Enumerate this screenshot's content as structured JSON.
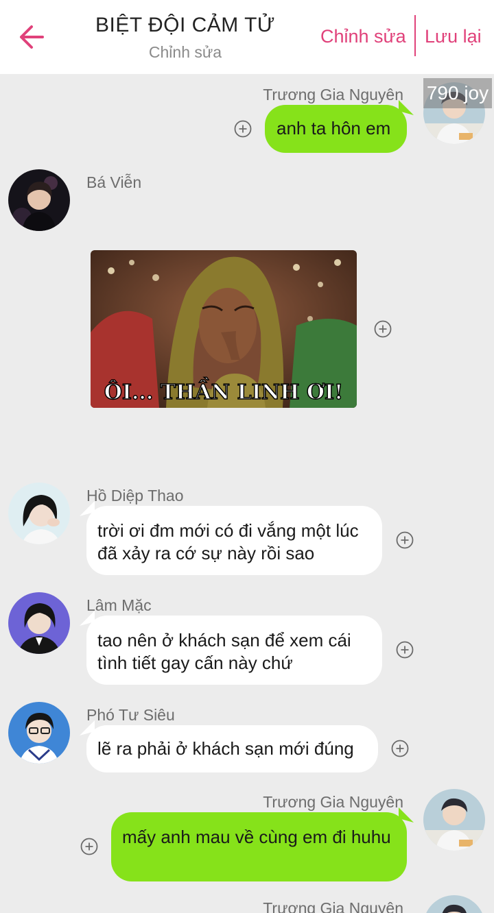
{
  "header": {
    "title": "BIỆT ĐỘI CẢM TỬ",
    "subtitle": "Chỉnh sửa",
    "edit_label": "Chỉnh sửa",
    "save_label": "Lưu lại",
    "accent": "#e0417a"
  },
  "badge": {
    "text": "790 joy"
  },
  "colors": {
    "outgoing": "#86e21a",
    "incoming": "#ffffff",
    "background": "#ececec"
  },
  "messages": [
    {
      "sender": "Trương Gia Nguyên",
      "text": "anh ta hôn em",
      "direction": "out"
    },
    {
      "sender": "Bá Viễn",
      "image_caption": "ÔI... THẦN LINH ƠI!",
      "direction": "in"
    },
    {
      "sender": "Hồ Diệp Thao",
      "text": "trời ơi đm mới có đi vắng một lúc đã xảy ra cớ sự này rồi sao",
      "direction": "in"
    },
    {
      "sender": "Lâm Mặc",
      "text": "tao nên ở khách sạn để xem cái tình tiết gay cấn này chứ",
      "direction": "in"
    },
    {
      "sender": "Phó Tư Siêu",
      "text": "lẽ ra phải ở khách sạn mới đúng",
      "direction": "in"
    },
    {
      "sender": "Trương Gia Nguyên",
      "text": "mấy anh mau về cùng em đi huhu",
      "direction": "out"
    },
    {
      "sender": "Trương Gia Nguyên",
      "direction": "out"
    }
  ]
}
